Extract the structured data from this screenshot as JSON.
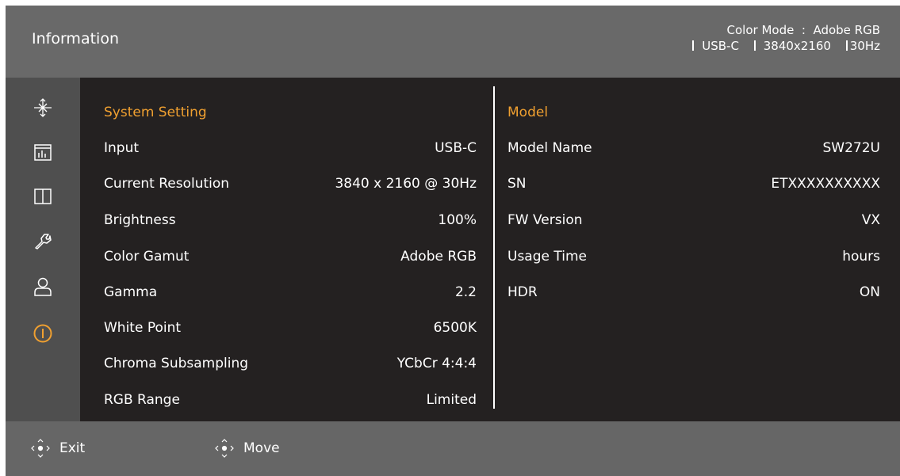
{
  "header": {
    "title": "Information",
    "color_mode_line": "Color Mode  :  Adobe RGB",
    "input": "USB-C",
    "resolution": "3840x2160",
    "refresh": "30Hz"
  },
  "sidebar": {
    "icons": [
      "sparkle-compass-icon",
      "chart-grid-icon",
      "split-window-icon",
      "wrench-icon",
      "user-icon",
      "power-info-icon"
    ],
    "active_color": "#f0a030"
  },
  "system": {
    "title": "System Setting",
    "rows": [
      {
        "label": "Input",
        "value": "USB-C"
      },
      {
        "label": "Current Resolution",
        "value": "3840 x 2160 @ 30Hz"
      },
      {
        "label": "Brightness",
        "value": "100%"
      },
      {
        "label": "Color Gamut",
        "value": "Adobe RGB"
      },
      {
        "label": "Gamma",
        "value": "2.2"
      },
      {
        "label": "White Point",
        "value": "6500K"
      },
      {
        "label": "Chroma Subsampling",
        "value": "YCbCr 4:4:4"
      },
      {
        "label": "RGB Range",
        "value": "Limited"
      }
    ]
  },
  "model": {
    "title": "Model",
    "rows": [
      {
        "label": "Model Name",
        "value": "SW272U"
      },
      {
        "label": "SN",
        "value": "ETXXXXXXXXXX"
      },
      {
        "label": "FW Version",
        "value": "VX"
      },
      {
        "label": "Usage Time",
        "value": "hours"
      },
      {
        "label": "HDR",
        "value": "ON"
      }
    ]
  },
  "footer": {
    "exit_label": "Exit",
    "move_label": "Move"
  },
  "colors": {
    "accent": "#f0a030",
    "header_bg": "#696969",
    "sidebar_bg": "#4f4f4f",
    "content_bg": "#242121"
  }
}
